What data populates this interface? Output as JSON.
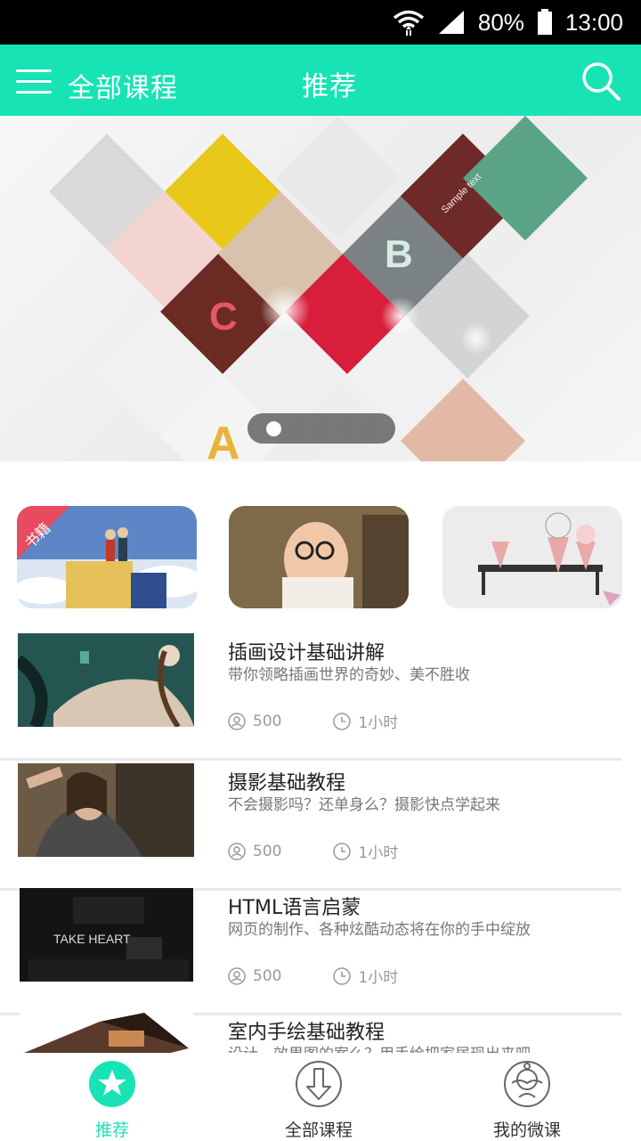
{
  "status": {
    "battery": "80%",
    "time": "13:00"
  },
  "appbar": {
    "title": "全部课程",
    "center": "推荐"
  },
  "banner": {
    "letters": [
      "C",
      "B",
      "A"
    ],
    "label": "Sample text",
    "page_count": 5,
    "active_page": 1
  },
  "categories": [
    {
      "name": "books-category",
      "badge": "书籍"
    },
    {
      "name": "baby-category"
    },
    {
      "name": "icecream-category"
    }
  ],
  "courses": [
    {
      "title": "插画设计基础讲解",
      "desc": "带你领略插画世界的奇妙、美不胜收",
      "students": "500",
      "duration": "1小时"
    },
    {
      "title": "摄影基础教程",
      "desc": "不会摄影吗？还单身么？摄影快点学起来",
      "students": "500",
      "duration": "1小时"
    },
    {
      "title": "HTML语言启蒙",
      "desc": "网页的制作、各种炫酷动态将在你的手中绽放",
      "students": "500",
      "duration": "1小时",
      "thumb_text": "TAKE HEART"
    },
    {
      "title": "室内手绘基础教程",
      "desc": "设计，效果图的案么？用手绘把家居现出来吧"
    }
  ],
  "nav": [
    {
      "label": "推荐",
      "icon": "star-icon",
      "active": true
    },
    {
      "label": "全部课程",
      "icon": "download-icon",
      "active": false
    },
    {
      "label": "我的微课",
      "icon": "profile-icon",
      "active": false
    }
  ],
  "colors": {
    "accent": "#18e3b4",
    "divider": "#e9e9e9"
  }
}
